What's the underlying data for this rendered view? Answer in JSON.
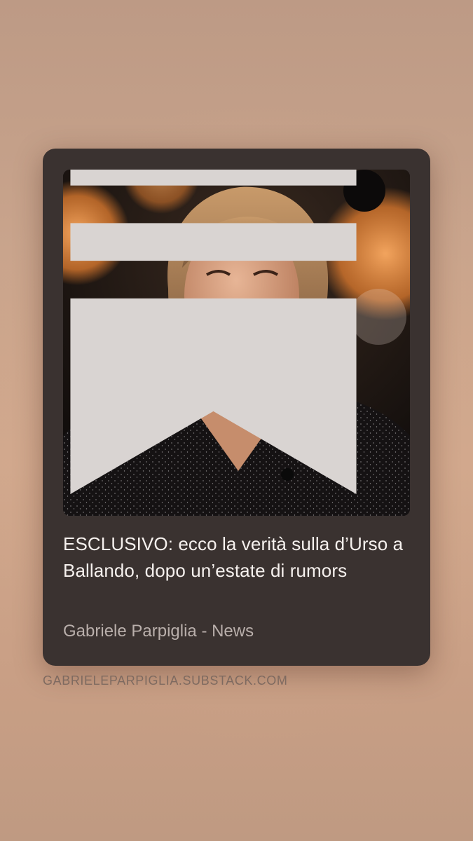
{
  "card": {
    "title": "ESCLUSIVO: ecco la verità sulla d’Urso a Ballando, dopo un’estate di rumors",
    "byline": "Gabriele Parpiglia - News",
    "image_icon": "substack-bookmark-icon"
  },
  "footer": {
    "source_domain": "GABRIELEPARPIGLIA.SUBSTACK.COM"
  },
  "colors": {
    "card_background": "#3a3230",
    "title_text": "#f6f1ee",
    "byline_text": "#b9afab",
    "domain_text": "#7e6a60"
  }
}
